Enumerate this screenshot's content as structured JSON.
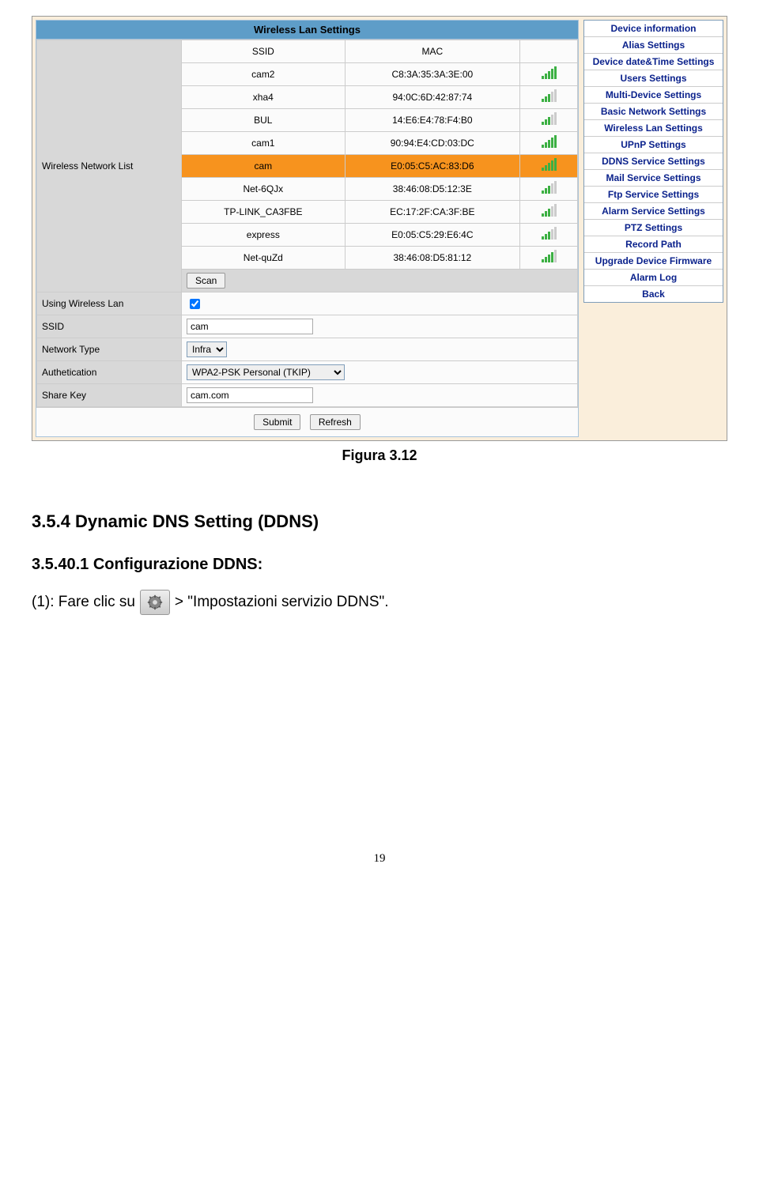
{
  "panel": {
    "title": "Wireless Lan Settings",
    "list_label": "Wireless Network List",
    "headers": {
      "ssid": "SSID",
      "mac": "MAC"
    },
    "networks": [
      {
        "ssid": "cam2",
        "mac": "C8:3A:35:3A:3E:00",
        "bars": 5,
        "selected": false
      },
      {
        "ssid": "xha4",
        "mac": "94:0C:6D:42:87:74",
        "bars": 3,
        "selected": false
      },
      {
        "ssid": "BUL",
        "mac": "14:E6:E4:78:F4:B0",
        "bars": 3,
        "selected": false
      },
      {
        "ssid": "cam1",
        "mac": "90:94:E4:CD:03:DC",
        "bars": 5,
        "selected": false
      },
      {
        "ssid": "cam",
        "mac": "E0:05:C5:AC:83:D6",
        "bars": 5,
        "selected": true
      },
      {
        "ssid": "Net-6QJx",
        "mac": "38:46:08:D5:12:3E",
        "bars": 3,
        "selected": false
      },
      {
        "ssid": "TP-LINK_CA3FBE",
        "mac": "EC:17:2F:CA:3F:BE",
        "bars": 3,
        "selected": false
      },
      {
        "ssid": "express",
        "mac": "E0:05:C5:29:E6:4C",
        "bars": 3,
        "selected": false
      },
      {
        "ssid": "Net-quZd",
        "mac": "38:46:08:D5:81:12",
        "bars": 4,
        "selected": false
      }
    ],
    "scan_btn": "Scan",
    "fields": {
      "using_label": "Using Wireless Lan",
      "ssid_label": "SSID",
      "ssid_value": "cam",
      "nettype_label": "Network Type",
      "nettype_value": "Infra",
      "auth_label": "Authetication",
      "auth_value": "WPA2-PSK Personal (TKIP)",
      "sharekey_label": "Share Key",
      "sharekey_value": "cam.com"
    },
    "submit_btn": "Submit",
    "refresh_btn": "Refresh"
  },
  "sidebar": {
    "items": [
      "Device information",
      "Alias Settings",
      "Device date&Time Settings",
      "Users Settings",
      "Multi-Device Settings",
      "Basic Network Settings",
      "Wireless Lan Settings",
      "UPnP Settings",
      "DDNS Service Settings",
      "Mail Service Settings",
      "Ftp Service Settings",
      "Alarm Service Settings",
      "PTZ Settings",
      "Record Path",
      "Upgrade Device Firmware",
      "Alarm Log",
      "Back"
    ]
  },
  "doc": {
    "caption": "Figura 3.12",
    "h2": "3.5.4 Dynamic DNS Setting (DDNS)",
    "h3": "3.5.40.1 Configurazione DDNS:",
    "step_pre": "(1): Fare clic su",
    "step_post": " > \"Impostazioni servizio DDNS\".",
    "page_num": "19"
  }
}
